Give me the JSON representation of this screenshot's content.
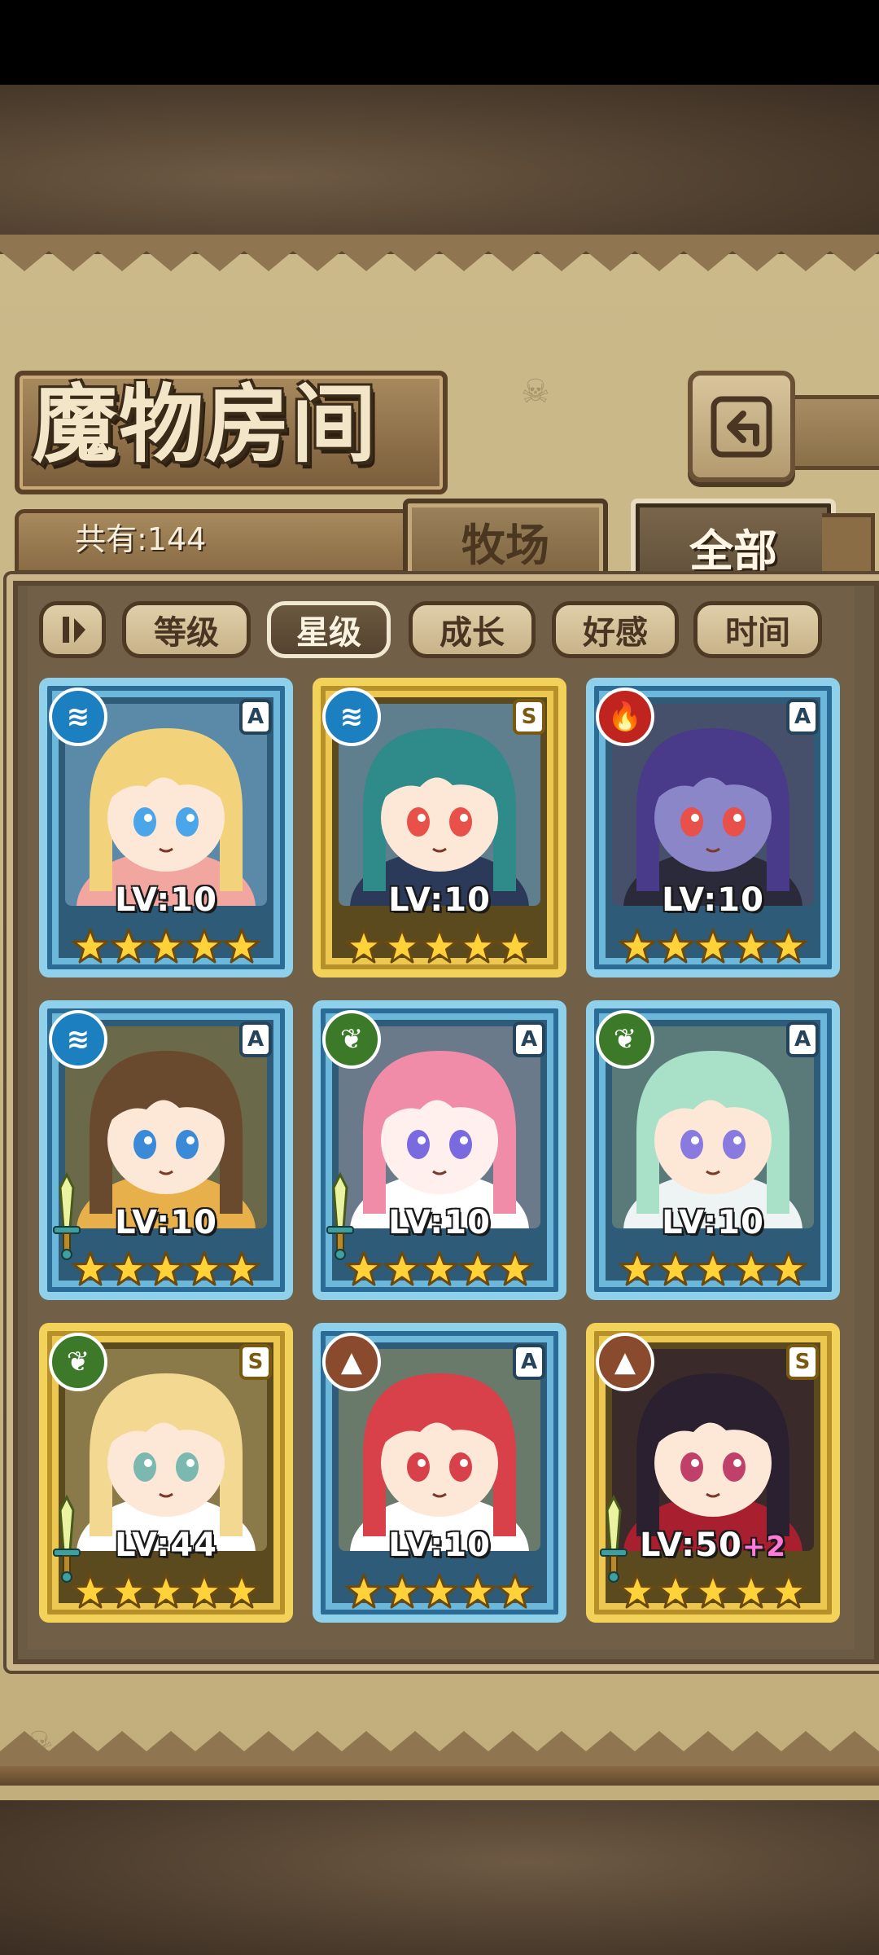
{
  "header": {
    "title": "魔物房间",
    "count_label": "共有:144"
  },
  "tabs": [
    {
      "label": "牧场",
      "active": false
    },
    {
      "label": "全部",
      "active": true
    }
  ],
  "sort_buttons": [
    {
      "label": "等级",
      "active": false
    },
    {
      "label": "星级",
      "active": true
    },
    {
      "label": "成长",
      "active": false
    },
    {
      "label": "好感",
      "active": false
    },
    {
      "label": "时间",
      "active": false
    }
  ],
  "cards": [
    {
      "element": "water",
      "frame": "blue",
      "grade": "A",
      "level": "LV:10",
      "plus": "",
      "stars": 5,
      "weapon": false,
      "palette": {
        "hair": "#f2d27a",
        "skin": "#fde7d6",
        "eye": "#4aa6e8",
        "cloth": "#f1a6a0",
        "bg": "#5b8aa8"
      }
    },
    {
      "element": "water",
      "frame": "gold",
      "grade": "S",
      "level": "LV:10",
      "plus": "",
      "stars": 5,
      "weapon": false,
      "palette": {
        "hair": "#2f8a8a",
        "skin": "#fde7d6",
        "eye": "#e8504a",
        "cloth": "#2c3a5a",
        "bg": "#5f7f8f"
      }
    },
    {
      "element": "fire",
      "frame": "blue",
      "grade": "A",
      "level": "LV:10",
      "plus": "",
      "stars": 5,
      "weapon": false,
      "palette": {
        "hair": "#4a3a8a",
        "skin": "#8b86c8",
        "eye": "#e8504a",
        "cloth": "#2a2a3a",
        "bg": "#46506a"
      }
    },
    {
      "element": "water",
      "frame": "blue",
      "grade": "A",
      "level": "LV:10",
      "plus": "",
      "stars": 5,
      "weapon": true,
      "palette": {
        "hair": "#6a4a2e",
        "skin": "#fde7d6",
        "eye": "#3a8ad8",
        "cloth": "#e8b04a",
        "bg": "#6a6a4a"
      }
    },
    {
      "element": "leaf",
      "frame": "blue",
      "grade": "A",
      "level": "LV:10",
      "plus": "",
      "stars": 5,
      "weapon": true,
      "palette": {
        "hair": "#f08ca8",
        "skin": "#fff0ee",
        "eye": "#7a6ae0",
        "cloth": "#ffffff",
        "bg": "#6a7a8a"
      }
    },
    {
      "element": "leaf",
      "frame": "blue",
      "grade": "A",
      "level": "LV:10",
      "plus": "",
      "stars": 5,
      "weapon": false,
      "palette": {
        "hair": "#a8e0c8",
        "skin": "#fde7d6",
        "eye": "#8a7ae0",
        "cloth": "#eef4f4",
        "bg": "#5a7a7a"
      }
    },
    {
      "element": "leaf",
      "frame": "gold",
      "grade": "S",
      "level": "LV:44",
      "plus": "",
      "stars": 5,
      "weapon": true,
      "palette": {
        "hair": "#f2d890",
        "skin": "#fde7d6",
        "eye": "#7ab8b0",
        "cloth": "#ffffff",
        "bg": "#8a7a4a"
      }
    },
    {
      "element": "earth",
      "frame": "blue",
      "grade": "A",
      "level": "LV:10",
      "plus": "",
      "stars": 5,
      "weapon": false,
      "palette": {
        "hair": "#d8404a",
        "skin": "#fde7d6",
        "eye": "#d8404a",
        "cloth": "#ffffff",
        "bg": "#6a7a6a"
      }
    },
    {
      "element": "earth",
      "frame": "gold",
      "grade": "S",
      "level": "LV:50",
      "plus": "+2",
      "stars": 5,
      "weapon": true,
      "palette": {
        "hair": "#2a2030",
        "skin": "#fde7d6",
        "eye": "#c0406a",
        "cloth": "#a82030",
        "bg": "#3a2a2a"
      }
    }
  ]
}
